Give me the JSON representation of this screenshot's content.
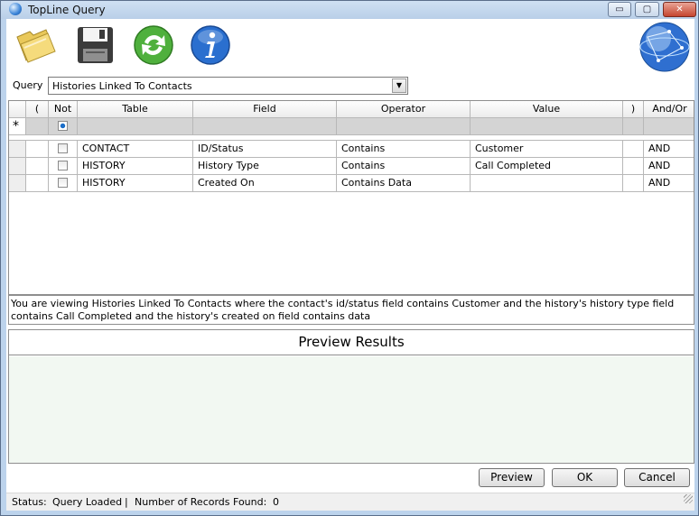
{
  "window": {
    "title": "TopLine Query",
    "minimize_glyph": "▭",
    "maximize_glyph": "▢",
    "close_glyph": "✕"
  },
  "toolbar": {
    "icons": [
      "folder-open-icon",
      "save-disk-icon",
      "refresh-icon",
      "info-icon"
    ],
    "logo": "globe-icon"
  },
  "query": {
    "label": "Query",
    "selected": "Histories Linked To Contacts"
  },
  "grid": {
    "headers": [
      "(",
      "Not",
      "Table",
      "Field",
      "Operator",
      "Value",
      ")",
      "And/Or"
    ],
    "new_row_marker": "*",
    "rows": [
      {
        "open": "",
        "not": false,
        "table": "CONTACT",
        "field": "ID/Status",
        "operator": "Contains",
        "value": "Customer",
        "close": "",
        "andor": "AND"
      },
      {
        "open": "",
        "not": false,
        "table": "HISTORY",
        "field": "History Type",
        "operator": "Contains",
        "value": "Call Completed",
        "close": "",
        "andor": "AND"
      },
      {
        "open": "",
        "not": false,
        "table": "HISTORY",
        "field": "Created On",
        "operator": "Contains Data",
        "value": "",
        "close": "",
        "andor": "AND"
      }
    ]
  },
  "description": "You are viewing Histories Linked To Contacts where the contact's id/status field contains Customer and the history's history type field contains Call Completed and the history's created on field contains data",
  "preview": {
    "title": "Preview Results"
  },
  "buttons": {
    "preview": "Preview",
    "ok": "OK",
    "cancel": "Cancel"
  },
  "status": {
    "label": "Status:",
    "state": "Query Loaded",
    "separator": "|",
    "records_label": "Number of Records Found:",
    "records_count": "0"
  },
  "colors": {
    "accent": "#1d6fc9",
    "frame": "#bcd3ec",
    "close_button": "#c5452f"
  }
}
